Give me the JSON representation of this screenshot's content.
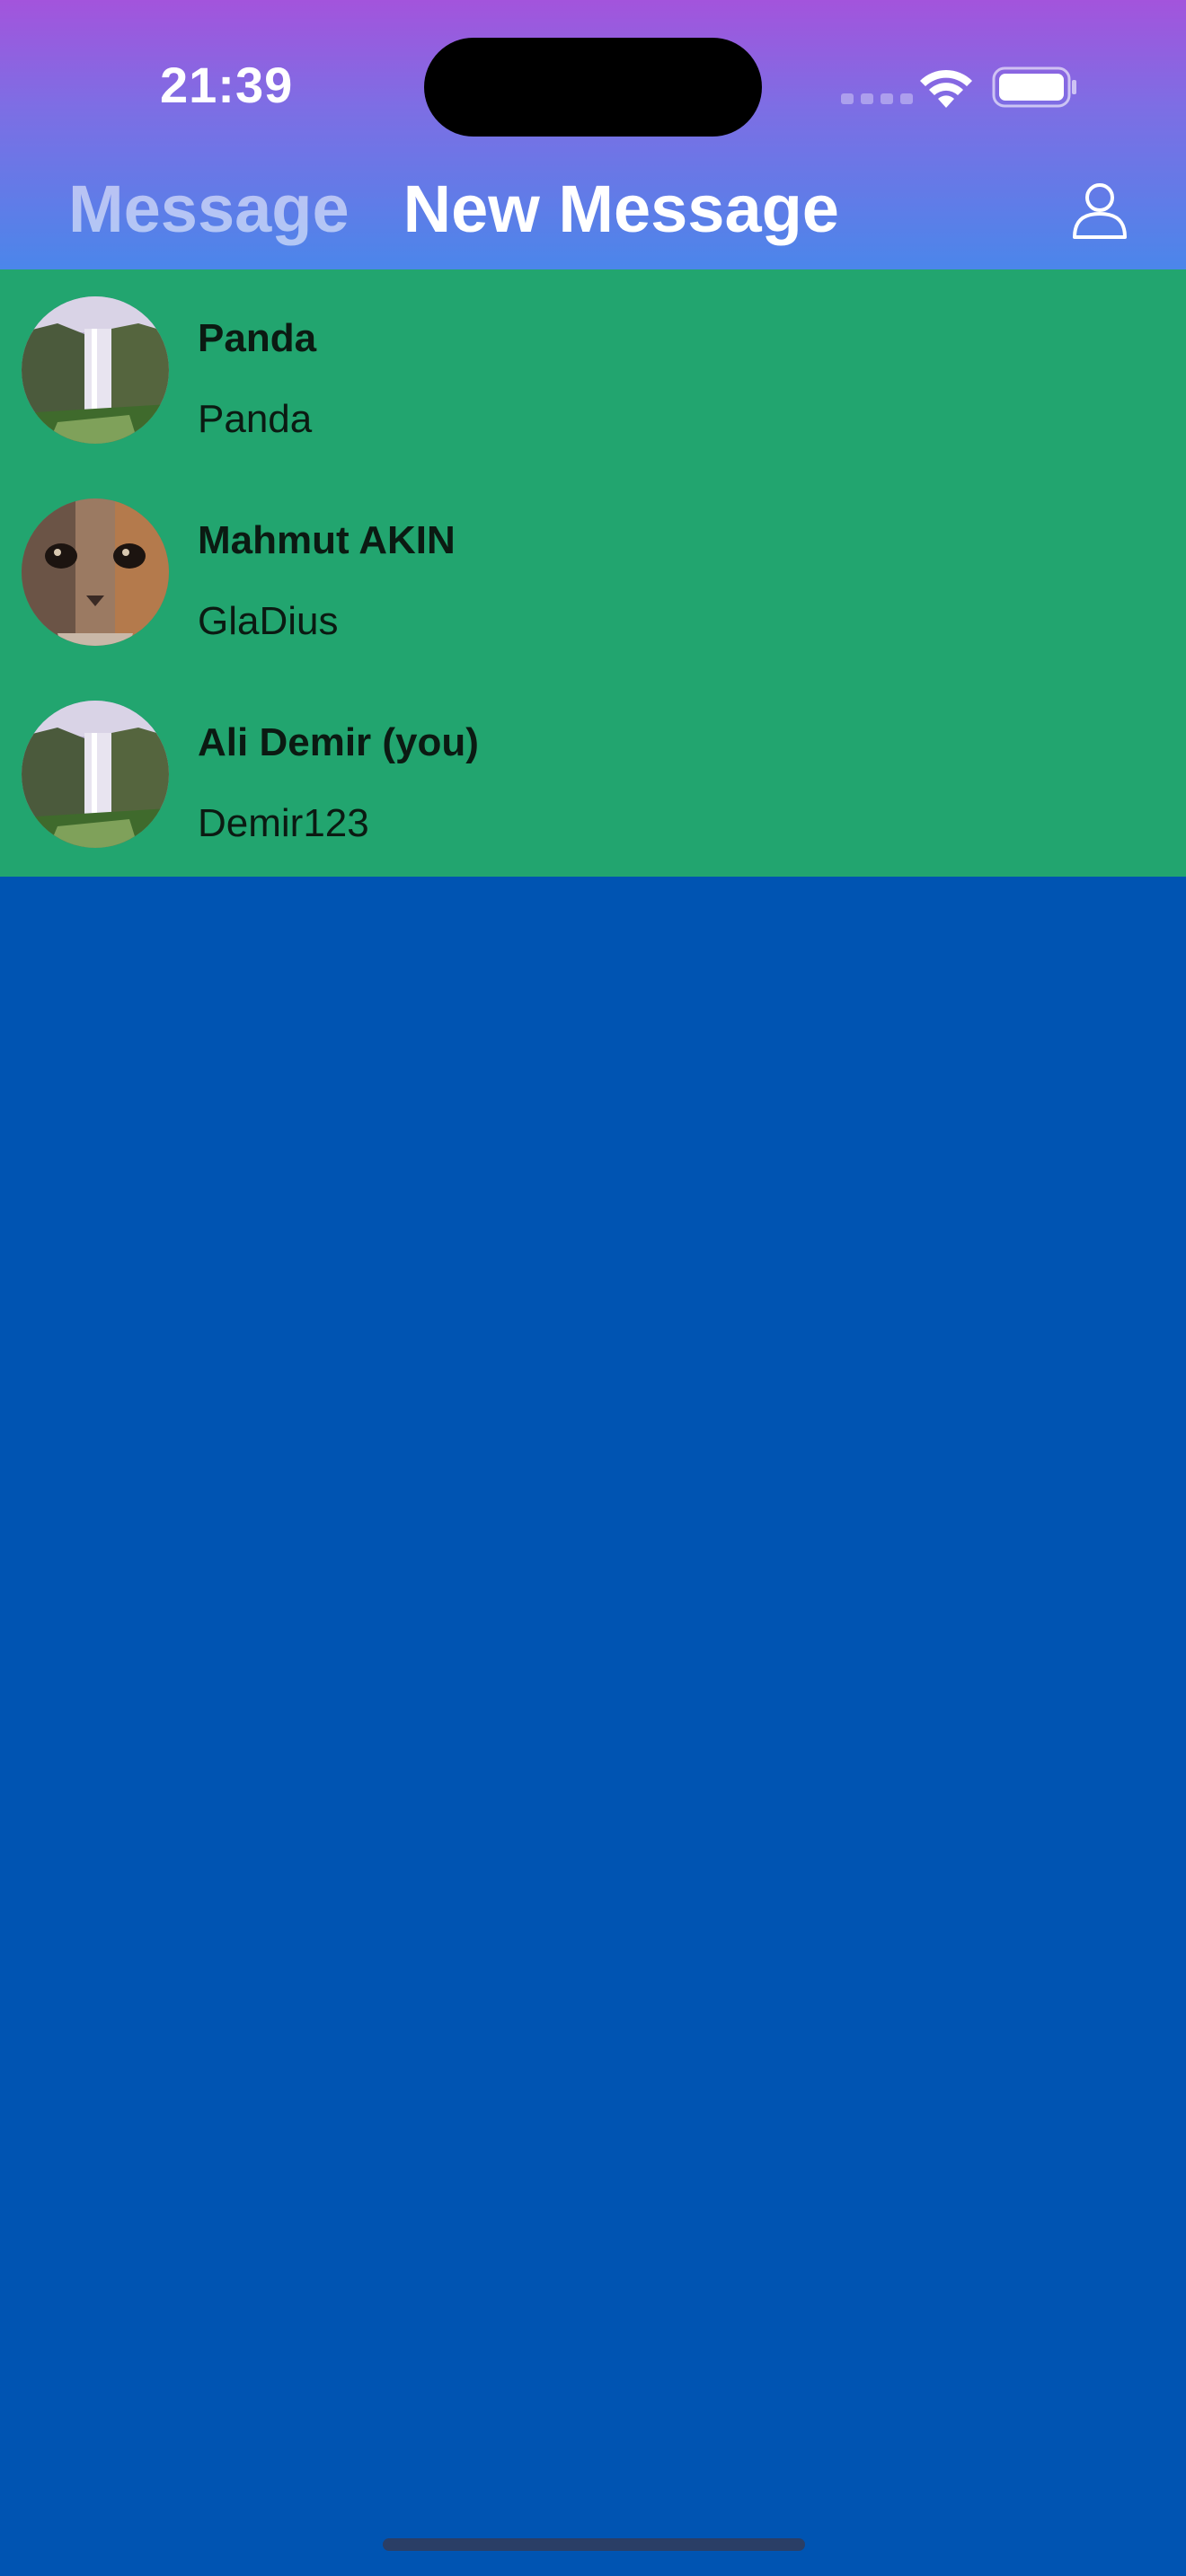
{
  "status_bar": {
    "time": "21:39",
    "wifi_icon": "wifi-icon",
    "battery_icon": "battery-icon"
  },
  "header": {
    "tabs": [
      {
        "label": "Message",
        "active": false
      },
      {
        "label": "New Message",
        "active": true
      }
    ],
    "profile_icon": "person-icon"
  },
  "users": [
    {
      "name": "Panda",
      "username": "Panda",
      "avatar": "waterfall-photo"
    },
    {
      "name": "Mahmut AKIN",
      "username": "GlaDius",
      "avatar": "cat-photo"
    },
    {
      "name": "Ali Demir (you)",
      "username": "Demir123",
      "avatar": "waterfall-photo"
    }
  ],
  "colors": {
    "header_gradient_top": "#a354dc",
    "header_gradient_bottom": "#4b86ea",
    "list_background": "#22a56f",
    "page_background": "#0054b2"
  }
}
